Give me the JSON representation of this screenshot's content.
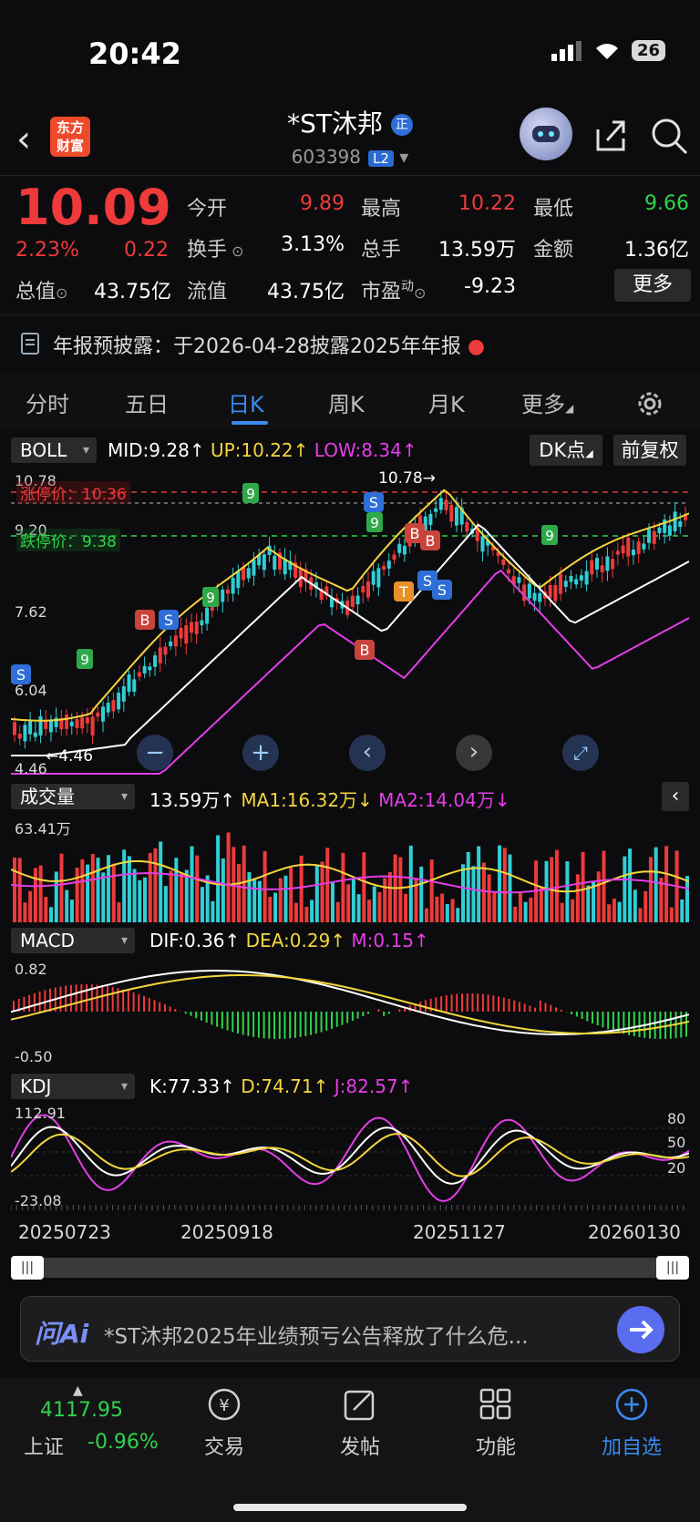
{
  "status": {
    "time": "20:42",
    "battery": "26"
  },
  "header": {
    "logo_line1": "东方",
    "logo_line2": "财富",
    "title": "*ST沐邦",
    "title_badge": "正",
    "code": "603398",
    "level": "L2"
  },
  "quote": {
    "price": "10.09",
    "change_pct": "2.23%",
    "change_abs": "0.22",
    "fields": [
      {
        "label": "今开",
        "value": "9.89",
        "color": "red"
      },
      {
        "label": "最高",
        "value": "10.22",
        "color": "red"
      },
      {
        "label": "最低",
        "value": "9.66",
        "color": "green"
      },
      {
        "label": "换手",
        "value": "3.13%",
        "color": "white"
      },
      {
        "label": "总手",
        "value": "13.59万",
        "color": "white"
      },
      {
        "label": "金额",
        "value": "1.36亿",
        "color": "white"
      },
      {
        "label": "总值",
        "value": "43.75亿",
        "color": "white"
      },
      {
        "label": "流值",
        "value": "43.75亿",
        "color": "white"
      },
      {
        "label": "市盈",
        "value": "-9.23",
        "color": "white"
      }
    ],
    "pe_superscript": "动",
    "more_label": "更多"
  },
  "notice": {
    "text": "年报预披露：于2026-04-28披露2025年年报"
  },
  "tabs": [
    {
      "label": "分时"
    },
    {
      "label": "五日"
    },
    {
      "label": "日K"
    },
    {
      "label": "周K"
    },
    {
      "label": "月K"
    },
    {
      "label": "更多"
    }
  ],
  "main_chart": {
    "indicator": "BOLL",
    "mid": "MID:9.28",
    "up": "UP:10.22",
    "low": "LOW:8.34",
    "dk_label": "DK点",
    "adjust_label": "前复权",
    "axis_top": "10.78",
    "axis_2": "9.20",
    "axis_3": "7.62",
    "axis_4": "6.04",
    "axis_bottom": "4.46",
    "limit_up": "涨停价：10.36",
    "limit_down": "跌停价：9.38",
    "high_marker": "10.78→",
    "low_marker": "←4.46"
  },
  "volume_chart": {
    "indicator": "成交量",
    "value": "13.59万",
    "ma1": "MA1:16.32万",
    "ma2": "MA2:14.04万",
    "axis_top": "63.41万"
  },
  "macd_chart": {
    "indicator": "MACD",
    "dif": "DIF:0.36",
    "dea": "DEA:0.29",
    "m": "M:0.15",
    "axis_top": "0.82",
    "axis_bottom": "-0.50"
  },
  "kdj_chart": {
    "indicator": "KDJ",
    "k": "K:77.33",
    "d": "D:74.71",
    "j": "J:82.57",
    "axis_top": "112.91",
    "axis_bottom": "-23.08",
    "level_80": "80",
    "level_50": "50",
    "level_20": "20"
  },
  "dates": [
    "20250723",
    "20250918",
    "20251127",
    "20260130"
  ],
  "ai_bar": {
    "logo": "问Ai",
    "text": "*ST沐邦2025年业绩预亏公告释放了什么危..."
  },
  "bottom_nav": {
    "index_value": "4117.95",
    "index_name": "上证",
    "index_change": "-0.96%",
    "items": [
      {
        "label": "交易"
      },
      {
        "label": "发帖"
      },
      {
        "label": "功能"
      },
      {
        "label": "加自选"
      }
    ]
  },
  "colors": {
    "up": "#ee3a3a",
    "down": "#2fd34a",
    "accent": "#3a8af0",
    "boll_up": "#f4d63d",
    "boll_low": "#e43ee6"
  }
}
